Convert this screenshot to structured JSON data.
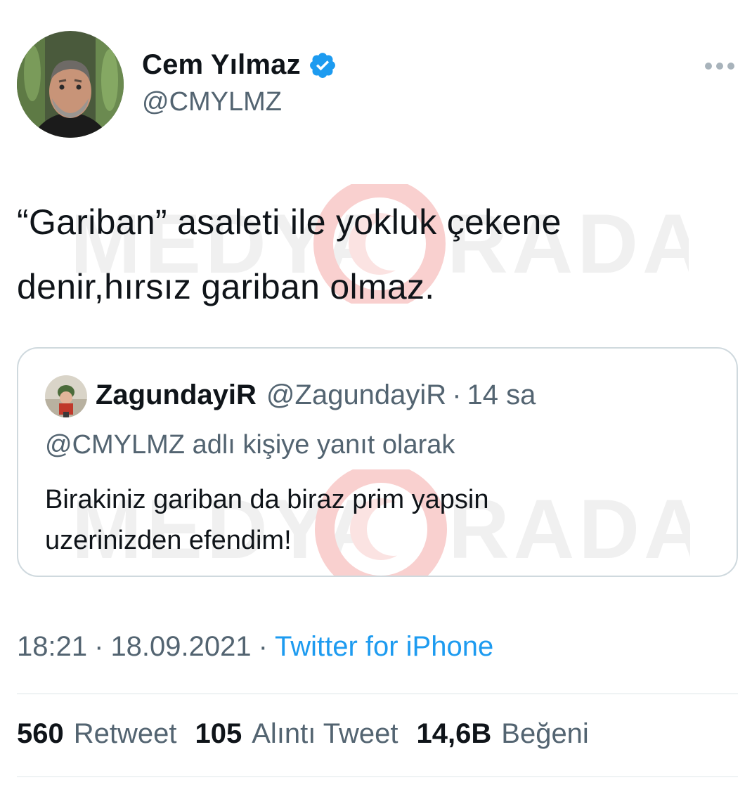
{
  "author": {
    "display_name": "Cem Yılmaz",
    "handle": "@CMYLMZ",
    "verified": true,
    "avatar_icon": "avatar-photo"
  },
  "more_icon": "more-dots-icon",
  "tweet": {
    "text_line1": "“Gariban” asaleti ile yokluk çekene",
    "text_line2": "denir,hırsız gariban olmaz."
  },
  "quoted_tweet": {
    "display_name": "ZagundayiR",
    "handle": "@ZagundayiR",
    "separator": "·",
    "time": "14 sa",
    "reply_context": "@CMYLMZ adlı kişiye yanıt olarak",
    "text_line1": "Birakiniz gariban da biraz prim yapsin",
    "text_line2": "uzerinizden efendim!"
  },
  "meta": {
    "time": "18:21",
    "separator": "·",
    "date": "18.09.2021",
    "source": "Twitter for iPhone"
  },
  "stats": {
    "retweets_count": "560",
    "retweets_label": "Retweet",
    "quotes_count": "105",
    "quotes_label": "Alıntı Tweet",
    "likes_count": "14,6B",
    "likes_label": "Beğeni"
  },
  "watermark": {
    "left_word": "MEDYA",
    "right_word": "RADAR"
  },
  "colors": {
    "text_primary": "#0f1419",
    "text_secondary": "#536471",
    "link": "#1d9bf0",
    "verified": "#1d9bf0",
    "border": "#cfd9de",
    "divider": "#eff3f4",
    "watermark_red": "#e53935"
  }
}
